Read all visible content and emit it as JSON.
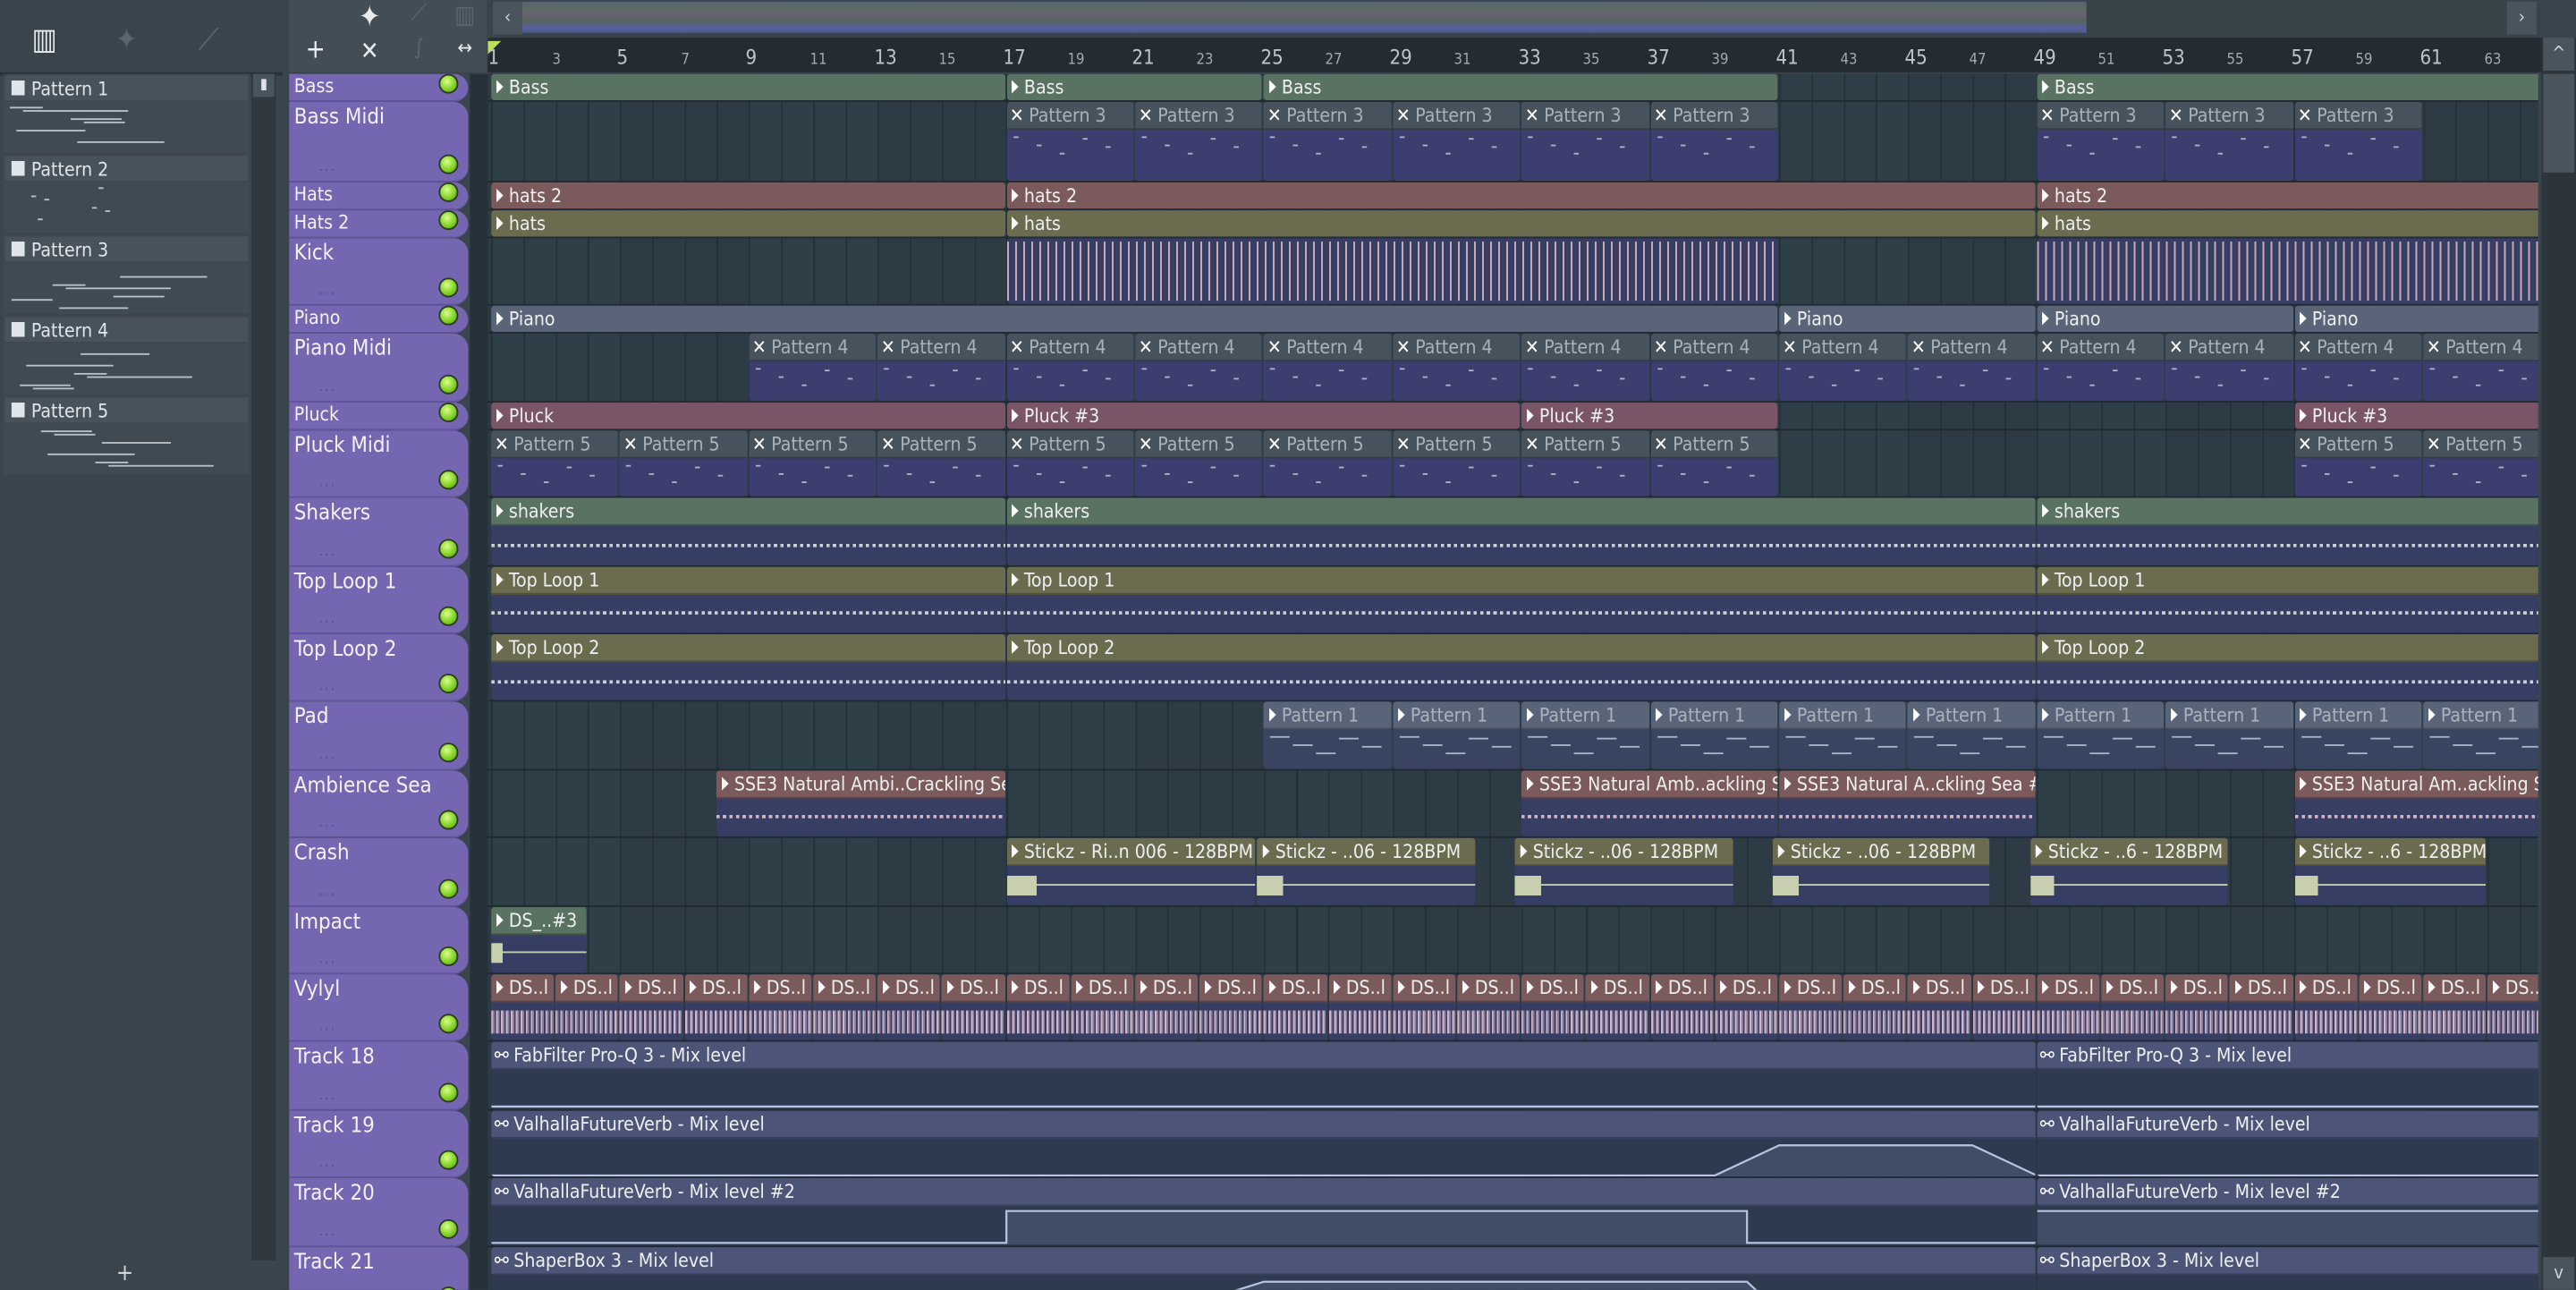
{
  "colors": {
    "track_header": "#7466b0",
    "grid": "#2f3f48",
    "green": "#5a7262",
    "red": "#7b5a5c",
    "olive": "#6b6b4f",
    "slate": "#5a6478",
    "mauve": "#7a5568",
    "navy_body": "#363f63",
    "pattern_header": "#46525c",
    "pattern_body": "#3c3e70",
    "automation": "#4c5578",
    "accent": "#8fd82a"
  },
  "toolbar": {
    "left_icons": [
      "piano-roll-icon",
      "audio-waveform-icon",
      "automation-icon"
    ],
    "add_label": "+",
    "right_icons": [
      "waveform-icon",
      "automation-icon",
      "piano-roll-icon",
      "cut-icon",
      "curve-icon",
      "stretch-icon"
    ]
  },
  "overview": {
    "prev": "‹",
    "next": "›"
  },
  "scroll": {
    "up": "^",
    "down": "v"
  },
  "ruler": [
    1,
    3,
    5,
    7,
    9,
    11,
    13,
    15,
    17,
    19,
    21,
    23,
    25,
    27,
    29,
    31,
    33,
    35,
    37,
    39,
    41,
    43,
    45,
    47,
    49,
    51,
    53,
    55,
    57,
    59,
    61,
    63
  ],
  "patterns": [
    {
      "name": "Pattern 1"
    },
    {
      "name": "Pattern 2"
    },
    {
      "name": "Pattern 3"
    },
    {
      "name": "Pattern 4"
    },
    {
      "name": "Pattern 5"
    }
  ],
  "add_pattern": "+",
  "tracks": [
    {
      "name": "Bass",
      "size": "small",
      "clips": [
        {
          "label": "Bass",
          "start": 1,
          "len": 16,
          "kind": "audio",
          "color": "green"
        },
        {
          "label": "Bass",
          "start": 17,
          "len": 8,
          "kind": "audio",
          "color": "green"
        },
        {
          "label": "Bass",
          "start": 25,
          "len": 16,
          "kind": "audio",
          "color": "green"
        },
        {
          "label": "Bass",
          "start": 49,
          "len": 16,
          "kind": "audio",
          "color": "green"
        }
      ]
    },
    {
      "name": "Bass Midi",
      "size": "midi",
      "clips": [
        {
          "label": "Pattern 3",
          "start": 17,
          "len": 4,
          "kind": "pattern"
        },
        {
          "label": "Pattern 3",
          "start": 21,
          "len": 4,
          "kind": "pattern"
        },
        {
          "label": "Pattern 3",
          "start": 25,
          "len": 4,
          "kind": "pattern"
        },
        {
          "label": "Pattern 3",
          "start": 29,
          "len": 4,
          "kind": "pattern"
        },
        {
          "label": "Pattern 3",
          "start": 33,
          "len": 4,
          "kind": "pattern"
        },
        {
          "label": "Pattern 3",
          "start": 37,
          "len": 4,
          "kind": "pattern"
        },
        {
          "label": "Pattern 3",
          "start": 49,
          "len": 4,
          "kind": "pattern"
        },
        {
          "label": "Pattern 3",
          "start": 53,
          "len": 4,
          "kind": "pattern"
        },
        {
          "label": "Pattern 3",
          "start": 57,
          "len": 4,
          "kind": "pattern"
        }
      ]
    },
    {
      "name": "Hats",
      "size": "small",
      "clips": [
        {
          "label": "hats 2",
          "start": 1,
          "len": 16,
          "kind": "audio",
          "color": "red"
        },
        {
          "label": "hats 2",
          "start": 17,
          "len": 32,
          "kind": "audio",
          "color": "red"
        },
        {
          "label": "hats 2",
          "start": 49,
          "len": 16,
          "kind": "audio",
          "color": "red"
        }
      ]
    },
    {
      "name": "Hats 2",
      "size": "small",
      "clips": [
        {
          "label": "hats",
          "start": 1,
          "len": 16,
          "kind": "audio",
          "color": "olive"
        },
        {
          "label": "hats",
          "start": 17,
          "len": 32,
          "kind": "audio",
          "color": "olive"
        },
        {
          "label": "hats",
          "start": 49,
          "len": 16,
          "kind": "audio",
          "color": "olive"
        }
      ]
    },
    {
      "name": "Kick",
      "size": "big",
      "clips": [
        {
          "label": "",
          "start": 17,
          "len": 24,
          "kind": "kick"
        },
        {
          "label": "",
          "start": 49,
          "len": 16,
          "kind": "kick"
        }
      ]
    },
    {
      "name": "Piano",
      "size": "small",
      "clips": [
        {
          "label": "Piano",
          "start": 1,
          "len": 40,
          "kind": "audio",
          "color": "slate"
        },
        {
          "label": "Piano",
          "start": 41,
          "len": 8,
          "kind": "audio",
          "color": "slate"
        },
        {
          "label": "Piano",
          "start": 49,
          "len": 8,
          "kind": "audio",
          "color": "slate"
        },
        {
          "label": "Piano",
          "start": 57,
          "len": 8,
          "kind": "audio",
          "color": "slate"
        }
      ]
    },
    {
      "name": "Piano Midi",
      "size": "big",
      "clips": [
        {
          "label": "Pattern 4",
          "start": 9,
          "len": 4,
          "kind": "pattern"
        },
        {
          "label": "Pattern 4",
          "start": 13,
          "len": 4,
          "kind": "pattern"
        },
        {
          "label": "Pattern 4",
          "start": 17,
          "len": 4,
          "kind": "pattern"
        },
        {
          "label": "Pattern 4",
          "start": 21,
          "len": 4,
          "kind": "pattern"
        },
        {
          "label": "Pattern 4",
          "start": 25,
          "len": 4,
          "kind": "pattern"
        },
        {
          "label": "Pattern 4",
          "start": 29,
          "len": 4,
          "kind": "pattern"
        },
        {
          "label": "Pattern 4",
          "start": 33,
          "len": 4,
          "kind": "pattern"
        },
        {
          "label": "Pattern 4",
          "start": 37,
          "len": 4,
          "kind": "pattern"
        },
        {
          "label": "Pattern 4",
          "start": 41,
          "len": 4,
          "kind": "pattern"
        },
        {
          "label": "Pattern 4",
          "start": 45,
          "len": 4,
          "kind": "pattern"
        },
        {
          "label": "Pattern 4",
          "start": 49,
          "len": 4,
          "kind": "pattern"
        },
        {
          "label": "Pattern 4",
          "start": 53,
          "len": 4,
          "kind": "pattern"
        },
        {
          "label": "Pattern 4",
          "start": 57,
          "len": 4,
          "kind": "pattern"
        },
        {
          "label": "Pattern 4",
          "start": 61,
          "len": 4,
          "kind": "pattern"
        }
      ]
    },
    {
      "name": "Pluck",
      "size": "small",
      "clips": [
        {
          "label": "Pluck",
          "start": 1,
          "len": 16,
          "kind": "audio",
          "color": "mauve"
        },
        {
          "label": "Pluck #3",
          "start": 17,
          "len": 16,
          "kind": "audio",
          "color": "mauve"
        },
        {
          "label": "Pluck #3",
          "start": 33,
          "len": 8,
          "kind": "audio",
          "color": "mauve"
        },
        {
          "label": "Pluck #3",
          "start": 57,
          "len": 8,
          "kind": "audio",
          "color": "mauve"
        }
      ]
    },
    {
      "name": "Pluck Midi",
      "size": "big",
      "clips": [
        {
          "label": "Pattern 5",
          "start": 1,
          "len": 4,
          "kind": "pattern"
        },
        {
          "label": "Pattern 5",
          "start": 5,
          "len": 4,
          "kind": "pattern"
        },
        {
          "label": "Pattern 5",
          "start": 9,
          "len": 4,
          "kind": "pattern"
        },
        {
          "label": "Pattern 5",
          "start": 13,
          "len": 4,
          "kind": "pattern"
        },
        {
          "label": "Pattern 5",
          "start": 17,
          "len": 4,
          "kind": "pattern"
        },
        {
          "label": "Pattern 5",
          "start": 21,
          "len": 4,
          "kind": "pattern"
        },
        {
          "label": "Pattern 5",
          "start": 25,
          "len": 4,
          "kind": "pattern"
        },
        {
          "label": "Pattern 5",
          "start": 29,
          "len": 4,
          "kind": "pattern"
        },
        {
          "label": "Pattern 5",
          "start": 33,
          "len": 4,
          "kind": "pattern"
        },
        {
          "label": "Pattern 5",
          "start": 37,
          "len": 4,
          "kind": "pattern"
        },
        {
          "label": "Pattern 5",
          "start": 57,
          "len": 4,
          "kind": "pattern"
        },
        {
          "label": "Pattern 5",
          "start": 61,
          "len": 4,
          "kind": "pattern"
        }
      ]
    },
    {
      "name": "Shakers",
      "size": "big",
      "clips": [
        {
          "label": "shakers",
          "start": 1,
          "len": 16,
          "kind": "audio",
          "color": "green"
        },
        {
          "label": "shakers",
          "start": 17,
          "len": 32,
          "kind": "audio",
          "color": "green"
        },
        {
          "label": "shakers",
          "start": 49,
          "len": 16,
          "kind": "audio",
          "color": "green"
        }
      ]
    },
    {
      "name": "Top Loop 1",
      "size": "big",
      "clips": [
        {
          "label": "Top Loop 1",
          "start": 1,
          "len": 16,
          "kind": "audio",
          "color": "olive"
        },
        {
          "label": "Top Loop 1",
          "start": 17,
          "len": 32,
          "kind": "audio",
          "color": "olive"
        },
        {
          "label": "Top Loop 1",
          "start": 49,
          "len": 16,
          "kind": "audio",
          "color": "olive"
        }
      ]
    },
    {
      "name": "Top Loop 2",
      "size": "big",
      "clips": [
        {
          "label": "Top Loop 2",
          "start": 1,
          "len": 16,
          "kind": "audio",
          "color": "olive"
        },
        {
          "label": "Top Loop 2",
          "start": 17,
          "len": 32,
          "kind": "audio",
          "color": "olive"
        },
        {
          "label": "Top Loop 2",
          "start": 49,
          "len": 16,
          "kind": "audio",
          "color": "olive"
        }
      ]
    },
    {
      "name": "Pad",
      "size": "big",
      "clips": [
        {
          "label": "Pattern 1",
          "start": 25,
          "len": 4,
          "kind": "padpattern"
        },
        {
          "label": "Pattern 1",
          "start": 29,
          "len": 4,
          "kind": "padpattern"
        },
        {
          "label": "Pattern 1",
          "start": 33,
          "len": 4,
          "kind": "padpattern"
        },
        {
          "label": "Pattern 1",
          "start": 37,
          "len": 4,
          "kind": "padpattern"
        },
        {
          "label": "Pattern 1",
          "start": 41,
          "len": 4,
          "kind": "padpattern"
        },
        {
          "label": "Pattern 1",
          "start": 45,
          "len": 4,
          "kind": "padpattern"
        },
        {
          "label": "Pattern 1",
          "start": 49,
          "len": 4,
          "kind": "padpattern"
        },
        {
          "label": "Pattern 1",
          "start": 53,
          "len": 4,
          "kind": "padpattern"
        },
        {
          "label": "Pattern 1",
          "start": 57,
          "len": 4,
          "kind": "padpattern"
        },
        {
          "label": "Pattern 1",
          "start": 61,
          "len": 4,
          "kind": "padpattern"
        }
      ]
    },
    {
      "name": "Ambience Sea",
      "size": "big",
      "clips": [
        {
          "label": "SSE3 Natural Ambi..Crackling Sea",
          "start": 8,
          "len": 9,
          "kind": "audio",
          "color": "red"
        },
        {
          "label": "SSE3 Natural Amb..ackling Sea",
          "start": 33,
          "len": 8,
          "kind": "audio",
          "color": "red"
        },
        {
          "label": "SSE3 Natural A..ckling Sea #2",
          "start": 41,
          "len": 8,
          "kind": "audio",
          "color": "red"
        },
        {
          "label": "SSE3 Natural Am..ackling Sea",
          "start": 57,
          "len": 8,
          "kind": "audio",
          "color": "red"
        }
      ]
    },
    {
      "name": "Crash",
      "size": "big",
      "clips": [
        {
          "label": "Stickz - Ri..n 006 - 128BPM",
          "start": 17,
          "len": 7.8,
          "kind": "crash",
          "color": "olive"
        },
        {
          "label": "Stickz - ..06 - 128BPM",
          "start": 24.8,
          "len": 6.8,
          "kind": "crash",
          "color": "olive"
        },
        {
          "label": "Stickz - ..06 - 128BPM",
          "start": 32.8,
          "len": 6.8,
          "kind": "crash",
          "color": "olive"
        },
        {
          "label": "Stickz - ..06 - 128BPM",
          "start": 40.8,
          "len": 6.8,
          "kind": "crash",
          "color": "olive"
        },
        {
          "label": "Stickz - ..6 - 128BPM",
          "start": 48.8,
          "len": 6.2,
          "kind": "crash",
          "color": "olive"
        },
        {
          "label": "Stickz - ..6 - 128BPM",
          "start": 57,
          "len": 6,
          "kind": "crash",
          "color": "olive"
        }
      ]
    },
    {
      "name": "Impact",
      "size": "big",
      "clips": [
        {
          "label": "DS_..#3",
          "start": 1,
          "len": 3,
          "kind": "crash",
          "color": "green"
        }
      ]
    },
    {
      "name": "Vylyl",
      "size": "big",
      "clips": "vylyl"
    },
    {
      "name": "Track 18",
      "size": "big",
      "clips": [
        {
          "label": "FabFilter Pro-Q 3 - Mix level",
          "start": 1,
          "len": 48,
          "kind": "auto"
        },
        {
          "label": "FabFilter Pro-Q 3 - Mix level",
          "start": 49,
          "len": 16,
          "kind": "auto"
        }
      ]
    },
    {
      "name": "Track 19",
      "size": "big",
      "clips": [
        {
          "label": "ValhallaFutureVerb - Mix level",
          "start": 1,
          "len": 48,
          "kind": "auto",
          "curve": [
            [
              0,
              0
            ],
            [
              38,
              0
            ],
            [
              40,
              0.9
            ],
            [
              46,
              0.9
            ],
            [
              48,
              0
            ]
          ]
        },
        {
          "label": "ValhallaFutureVerb - Mix level",
          "start": 49,
          "len": 16,
          "kind": "auto"
        }
      ]
    },
    {
      "name": "Track 20",
      "size": "big",
      "clips": [
        {
          "label": "ValhallaFutureVerb - Mix level #2",
          "start": 1,
          "len": 48,
          "kind": "auto",
          "curve": [
            [
              0,
              0
            ],
            [
              16,
              0
            ],
            [
              16,
              0.95
            ],
            [
              39,
              0.95
            ],
            [
              39,
              0
            ],
            [
              48,
              0
            ]
          ]
        },
        {
          "label": "ValhallaFutureVerb - Mix level #2",
          "start": 49,
          "len": 16,
          "kind": "auto",
          "curve": [
            [
              0,
              0.95
            ],
            [
              16,
              0.95
            ]
          ]
        }
      ]
    },
    {
      "name": "Track 21",
      "size": "big",
      "clips": [
        {
          "label": "ShaperBox 3 - Mix level",
          "start": 1,
          "len": 48,
          "kind": "auto",
          "curve": [
            [
              0,
              0
            ],
            [
              21,
              0
            ],
            [
              24,
              0.9
            ],
            [
              39,
              0.9
            ],
            [
              40,
              0
            ]
          ]
        },
        {
          "label": "ShaperBox 3 - Mix level",
          "start": 49,
          "len": 16,
          "kind": "auto"
        }
      ]
    }
  ],
  "vylyl_clip": {
    "label": "DS..l",
    "count": 32,
    "len": 2
  }
}
